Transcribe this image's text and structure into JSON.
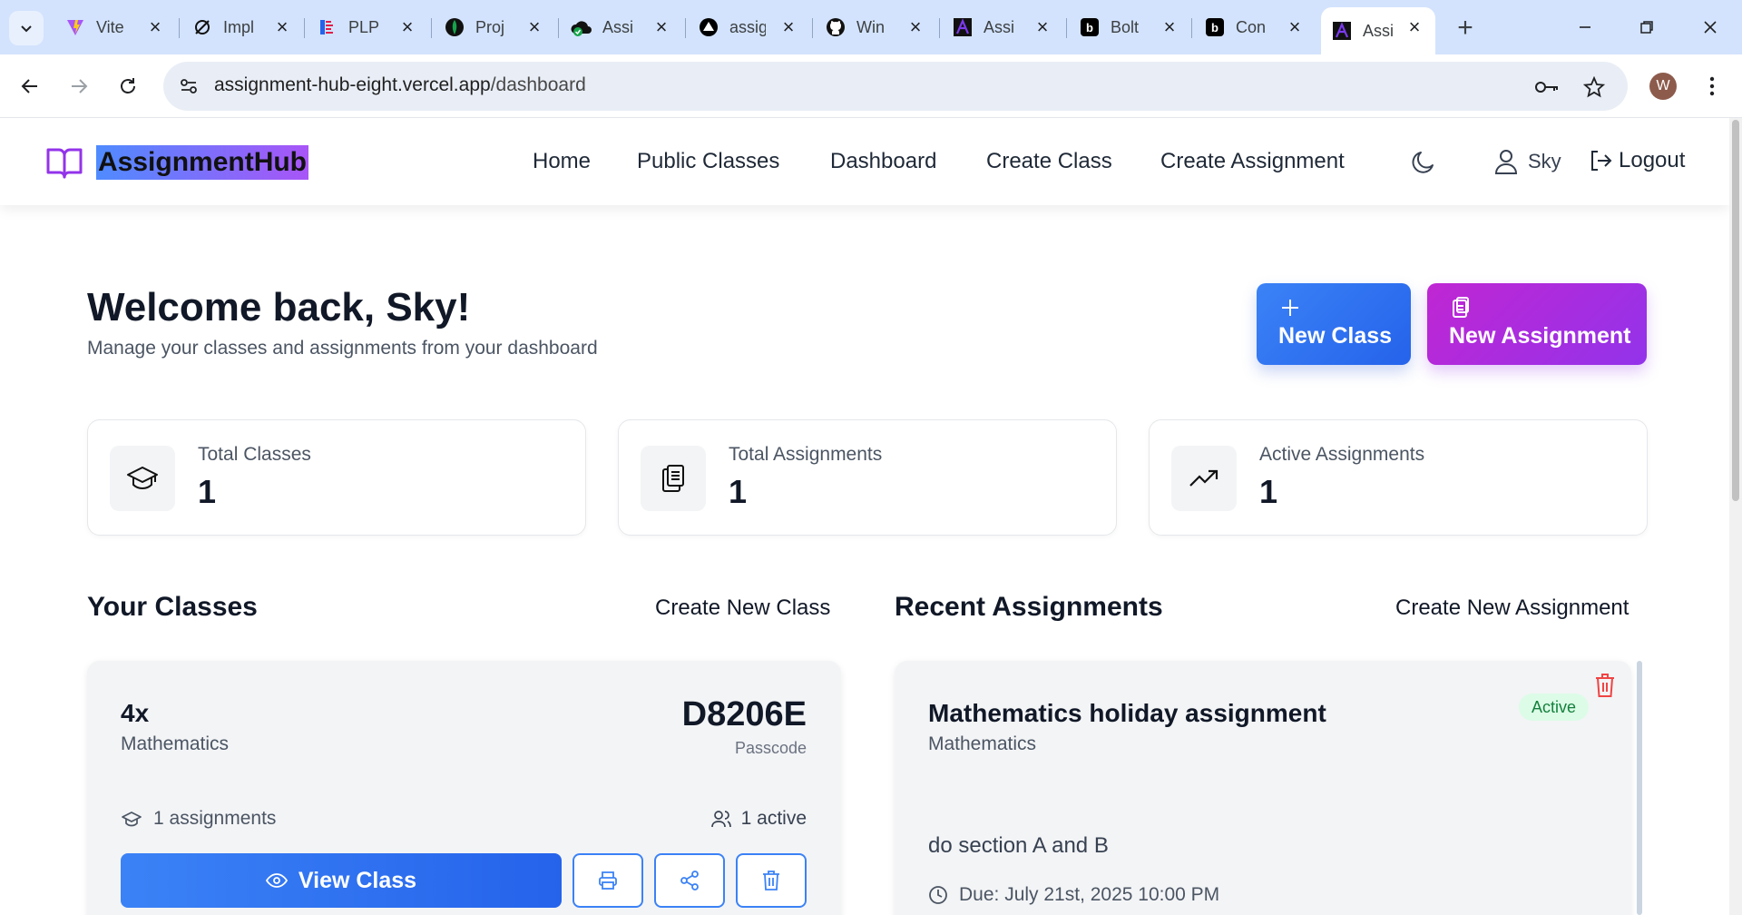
{
  "browser": {
    "tabs": [
      {
        "label": "Vite",
        "icon": "vite-icon",
        "color": "#a855f7"
      },
      {
        "label": "Impl",
        "icon": "spiral-icon",
        "color": "#111111"
      },
      {
        "label": "PLP",
        "icon": "plp-icon",
        "color": "#e11d48"
      },
      {
        "label": "Proj",
        "icon": "leaf-icon",
        "color": "#16a34a"
      },
      {
        "label": "Assi",
        "icon": "check-cloud-icon",
        "color": "#16a34a"
      },
      {
        "label": "assig",
        "icon": "vercel-triangle-icon",
        "color": "#000000"
      },
      {
        "label": "Win",
        "icon": "github-icon",
        "color": "#111111"
      },
      {
        "label": "Assi",
        "icon": "assignmenthub-favicon",
        "color": "#7c3aed"
      },
      {
        "label": "Bolt",
        "icon": "bolt-icon",
        "color": "#000000"
      },
      {
        "label": "Con",
        "icon": "bolt-icon",
        "color": "#000000"
      },
      {
        "label": "Assi",
        "icon": "assignmenthub-favicon",
        "color": "#7c3aed",
        "active": true
      }
    ],
    "url_host": "assignment-hub-eight.vercel.app",
    "url_path": "/dashboard",
    "profile_initial": "W"
  },
  "header": {
    "brand": "AssignmentHub",
    "nav": [
      "Home",
      "Public Classes",
      "Dashboard",
      "Create Class",
      "Create Assignment"
    ],
    "user_name": "Sky",
    "logout_label": "Logout"
  },
  "hero": {
    "welcome": "Welcome back, Sky!",
    "subtitle": "Manage your classes and assignments from your dashboard",
    "new_class_label": "New Class",
    "new_assignment_label": "New Assignment"
  },
  "stats": [
    {
      "label": "Total Classes",
      "value": "1",
      "icon": "graduation-cap-icon"
    },
    {
      "label": "Total Assignments",
      "value": "1",
      "icon": "clipboard-icon"
    },
    {
      "label": "Active Assignments",
      "value": "1",
      "icon": "trending-up-icon"
    }
  ],
  "classes_section": {
    "title": "Your Classes",
    "link": "Create New Class",
    "card": {
      "name": "4x",
      "subject": "Mathematics",
      "passcode": "D8206E",
      "passcode_label": "Passcode",
      "assignments": "1 assignments",
      "active": "1 active",
      "view_label": "View Class"
    }
  },
  "assignments_section": {
    "title": "Recent Assignments",
    "link": "Create New Assignment",
    "card": {
      "title": "Mathematics holiday assignment",
      "subject": "Mathematics",
      "status": "Active",
      "description": "do section A and B",
      "due": "Due: July 21st, 2025 10:00 PM"
    }
  },
  "colors": {
    "primary_blue": "#2563eb",
    "accent_purple": "#9333ea",
    "status_green": "#15803d",
    "danger_red": "#ef4444"
  }
}
